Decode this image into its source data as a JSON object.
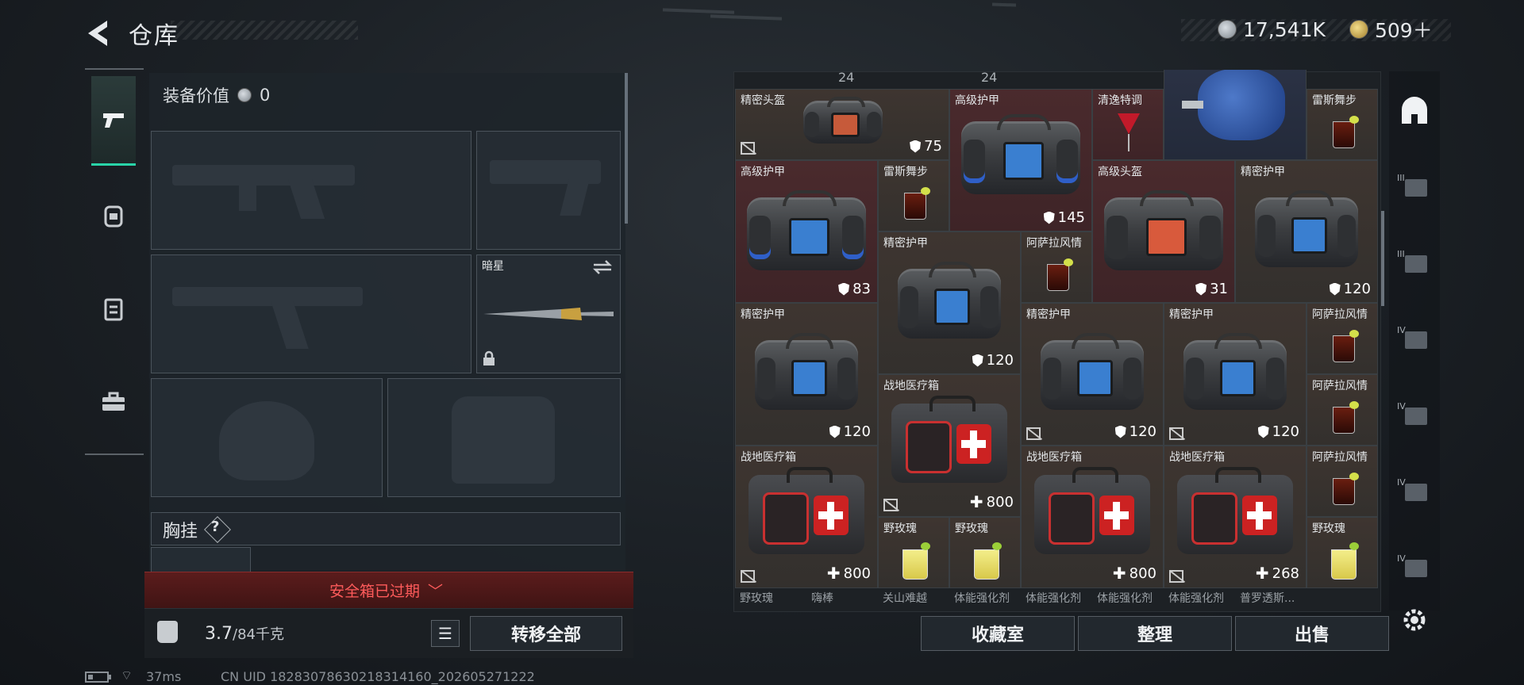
{
  "header": {
    "title": "仓库",
    "currency_silver": "17,541K",
    "currency_gold": "509＋"
  },
  "left_rail": {
    "tabs": [
      {
        "name": "weapons",
        "icon": "pistol-icon",
        "active": true
      },
      {
        "name": "gear",
        "icon": "backpack-icon",
        "active": false
      },
      {
        "name": "vest",
        "icon": "vest-icon",
        "active": false
      },
      {
        "name": "supplies",
        "icon": "toolbox-icon",
        "active": false
      }
    ]
  },
  "equipment": {
    "value_label": "装备价值",
    "value": "0",
    "melee_slot": {
      "name": "暗星"
    },
    "chest_rig_label": "胸挂",
    "chest_rig_help": "?",
    "alert": "安全箱已过期",
    "weight_current": "3.7",
    "weight_max": "/84千克",
    "transfer_all": "转移全部"
  },
  "status": {
    "ping": "37ms",
    "uid": "CN UID 1828307863021831416​0_202605271222"
  },
  "grid": {
    "top_counts": [
      "24",
      "24"
    ],
    "items": [
      {
        "name": "精密头盔",
        "dur": "75",
        "kind": "bag",
        "bg": "brown",
        "nosell": true
      },
      {
        "name": "高级护甲",
        "dur": "145",
        "kind": "bag",
        "bg": "red"
      },
      {
        "name": "清逸特调",
        "dur": "",
        "kind": "cocktail",
        "bg": "red"
      },
      {
        "name": "",
        "dur": "",
        "kind": "motor",
        "bg": "blue"
      },
      {
        "name": "雷斯舞步",
        "dur": "",
        "kind": "dark",
        "bg": "brown"
      },
      {
        "name": "高级护甲",
        "dur": "83",
        "kind": "bag",
        "bg": "red"
      },
      {
        "name": "雷斯舞步",
        "dur": "",
        "kind": "dark",
        "bg": "brown"
      },
      {
        "name": "高级头盔",
        "dur": "31",
        "kind": "bag",
        "bg": "red"
      },
      {
        "name": "精密护甲",
        "dur": "120",
        "kind": "bag",
        "bg": "brown"
      },
      {
        "name": "精密护甲",
        "dur": "120",
        "kind": "bag",
        "bg": "brown"
      },
      {
        "name": "阿萨拉风情",
        "dur": "",
        "kind": "dark",
        "bg": "brown"
      },
      {
        "name": "精密护甲",
        "dur": "120",
        "kind": "bag",
        "bg": "brown"
      },
      {
        "name": "精密护甲",
        "dur": "120",
        "kind": "bag",
        "bg": "brown",
        "nosell": true
      },
      {
        "name": "精密护甲",
        "dur": "120",
        "kind": "bag",
        "bg": "brown",
        "nosell": true
      },
      {
        "name": "阿萨拉风情",
        "dur": "",
        "kind": "dark",
        "bg": "brown"
      },
      {
        "name": "阿萨拉风情",
        "dur": "",
        "kind": "dark",
        "bg": "brown"
      },
      {
        "name": "战地医疗箱",
        "dur": "800",
        "kind": "medkit",
        "bg": "brown",
        "nosell": true
      },
      {
        "name": "战地医疗箱",
        "dur": "800",
        "kind": "medkit",
        "bg": "brown",
        "nosell": true
      },
      {
        "name": "战地医疗箱",
        "dur": "800",
        "kind": "medkit",
        "bg": "brown"
      },
      {
        "name": "战地医疗箱",
        "dur": "268",
        "kind": "medkit",
        "bg": "brown",
        "nosell": true
      },
      {
        "name": "阿萨拉风情",
        "dur": "",
        "kind": "dark",
        "bg": "brown"
      },
      {
        "name": "野玫瑰",
        "dur": "",
        "kind": "yellow",
        "bg": "brown"
      },
      {
        "name": "野玫瑰",
        "dur": "",
        "kind": "yellow",
        "bg": "brown"
      },
      {
        "name": "野玫瑰",
        "dur": "",
        "kind": "yellow",
        "bg": "brown"
      }
    ],
    "bottom_row_labels": [
      "野玫瑰",
      "嗨棒",
      "关山难越",
      "体能强化剂",
      "体能强化剂",
      "体能强化剂",
      "体能强化剂",
      "普罗透斯..."
    ]
  },
  "grid_buttons": {
    "collection": "收藏室",
    "sort": "整理",
    "sell": "出售"
  },
  "right_rail": {
    "tiers": [
      "III",
      "III",
      "IV",
      "IV",
      "IV",
      "IV"
    ]
  }
}
